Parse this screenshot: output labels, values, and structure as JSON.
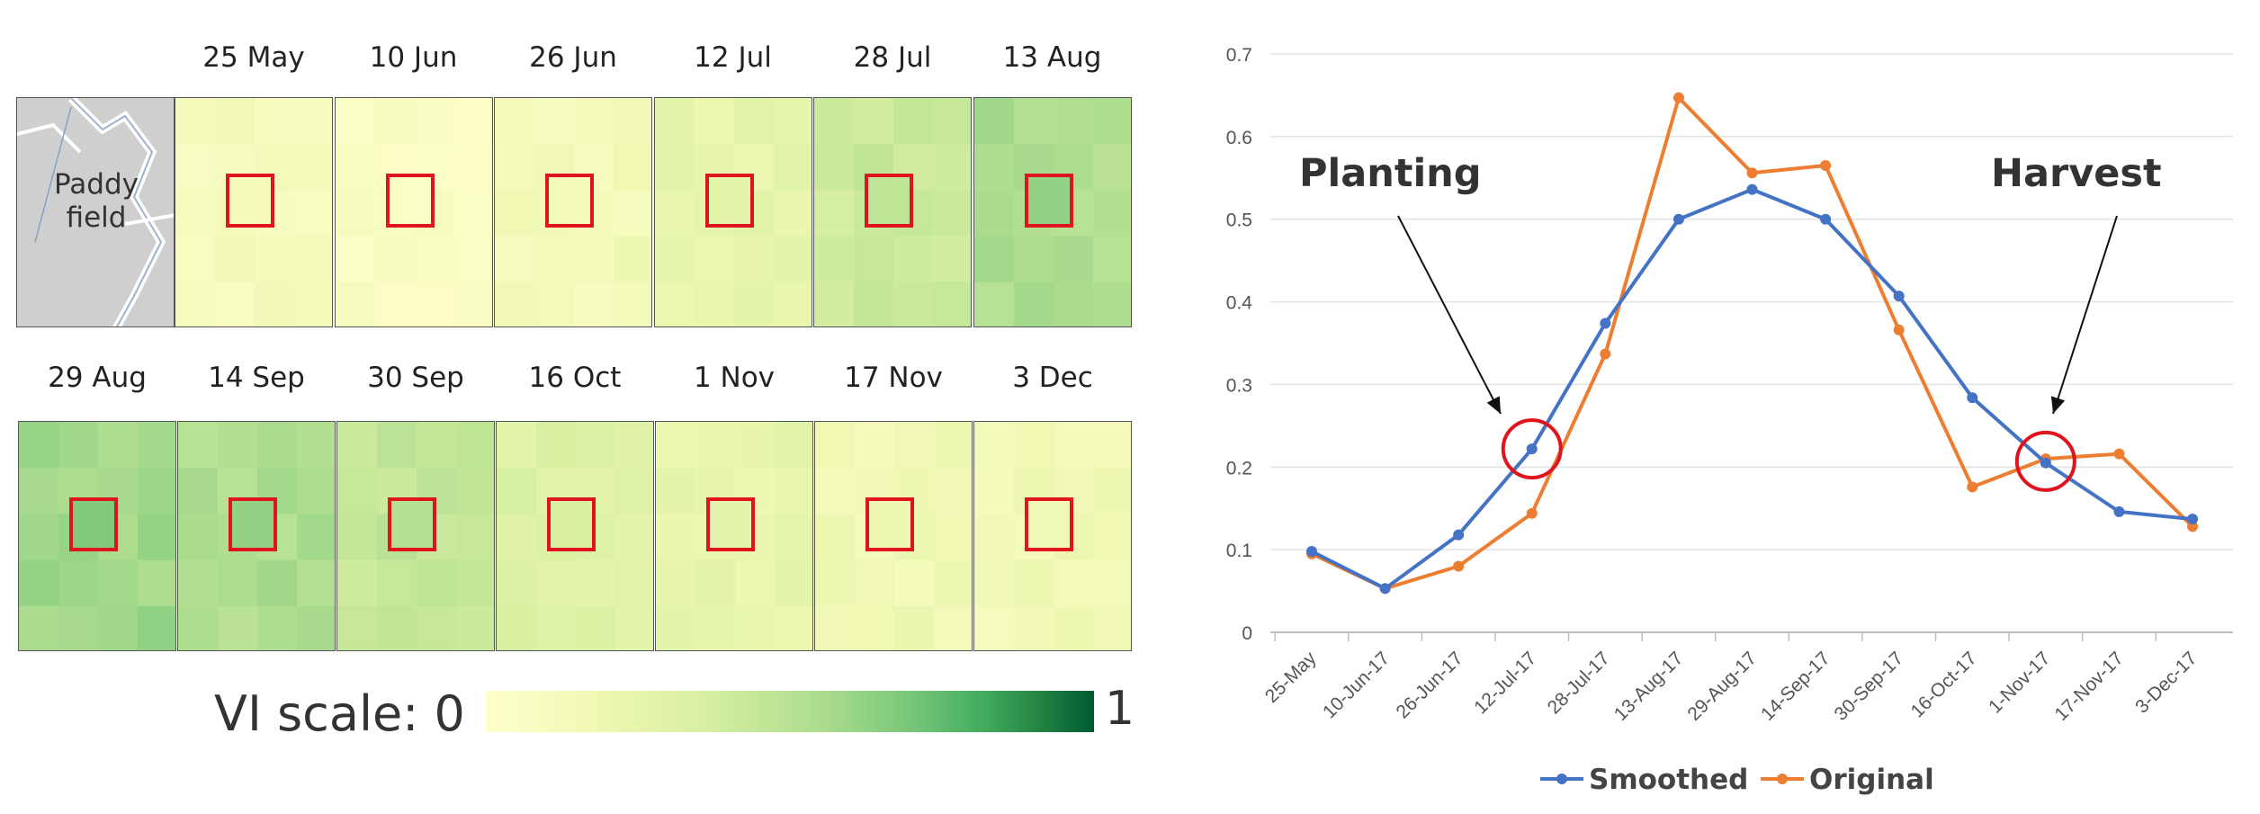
{
  "figure": {
    "tile_dates_row1": [
      "25 May",
      "10 Jun",
      "26 Jun",
      "12 Jul",
      "28 Jul",
      "13 Aug"
    ],
    "tile_dates_row2": [
      "29 Aug",
      "14 Sep",
      "30 Sep",
      "16 Oct",
      "1 Nov",
      "17 Nov",
      "3 Dec"
    ],
    "paddy_label_line1": "Paddy",
    "paddy_label_line2": "field",
    "scale_label": "VI scale: 0",
    "scale_max": "1",
    "tile_levels": {
      "25 May": 0.1,
      "10 Jun": 0.05,
      "26 Jun": 0.12,
      "12 Jul": 0.22,
      "28 Jul": 0.38,
      "13 Aug": 0.5,
      "29 Aug": 0.54,
      "14 Sep": 0.5,
      "30 Sep": 0.41,
      "16 Oct": 0.28,
      "1 Nov": 0.21,
      "17 Nov": 0.15,
      "3 Dec": 0.14
    }
  },
  "colors": {
    "smoothed": "#4472C4",
    "original": "#ED7D31",
    "marker": "#E0141E",
    "tile_box": "#E0141E"
  },
  "chart_data": {
    "type": "line",
    "categories": [
      "25-May",
      "10-Jun-17",
      "26-Jun-17",
      "12-Jul-17",
      "28-Jul-17",
      "13-Aug-17",
      "29-Aug-17",
      "14-Sep-17",
      "30-Sep-17",
      "16-Oct-17",
      "1-Nov-17",
      "17-Nov-17",
      "3-Dec-17"
    ],
    "series": [
      {
        "name": "Smoothed",
        "values": [
          0.098,
          0.053,
          0.118,
          0.222,
          0.374,
          0.5,
          0.536,
          0.5,
          0.407,
          0.284,
          0.205,
          0.146,
          0.137
        ]
      },
      {
        "name": "Original",
        "values": [
          0.095,
          0.053,
          0.08,
          0.144,
          0.337,
          0.647,
          0.556,
          0.565,
          0.366,
          0.176,
          0.21,
          0.216,
          0.128
        ]
      }
    ],
    "ylim": [
      0,
      0.7
    ],
    "yticks": [
      "0",
      "0.1",
      "0.2",
      "0.3",
      "0.4",
      "0.5",
      "0.6",
      "0.7"
    ],
    "grid": true,
    "legend_position": "bottom",
    "annotations": [
      {
        "text": "Planting",
        "category_index": 3,
        "value": 0.222
      },
      {
        "text": "Harvest",
        "category_index": 10,
        "value": 0.207
      }
    ]
  }
}
